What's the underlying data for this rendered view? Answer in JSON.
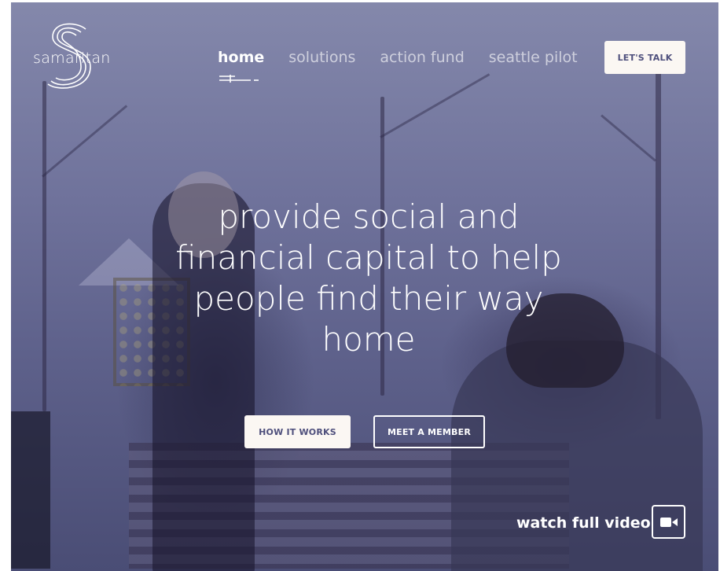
{
  "brand": {
    "name": "samaritan"
  },
  "nav": {
    "items": [
      {
        "label": "home",
        "active": true
      },
      {
        "label": "solutions",
        "active": false
      },
      {
        "label": "action fund",
        "active": false
      },
      {
        "label": "seattle pilot",
        "active": false
      }
    ],
    "cta_label": "LET'S TALK"
  },
  "hero": {
    "title": "provide social and financial capital to help people find their way home",
    "primary_button": "HOW IT WORKS",
    "secondary_button": "MEET A MEMBER"
  },
  "video": {
    "label": "watch full video",
    "icon": "video-camera-icon"
  },
  "colors": {
    "overlay": "#5f628c",
    "button_bg": "#fbf7f3",
    "button_text": "#4e4f7c"
  }
}
